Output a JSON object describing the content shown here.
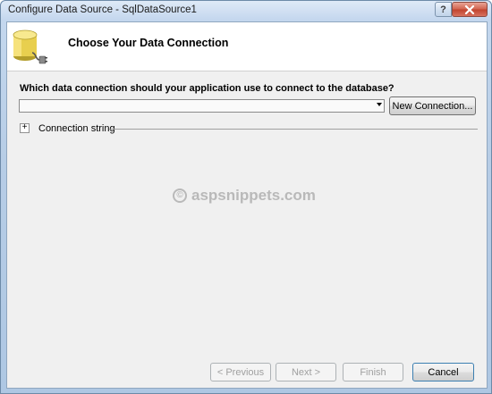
{
  "window": {
    "title": "Configure Data Source - SqlDataSource1",
    "help_label": "?",
    "close_label": "✕"
  },
  "header": {
    "icon": "database-icon",
    "title": "Choose Your Data Connection"
  },
  "connection": {
    "question": "Which data connection should your application use to connect to the database?",
    "selected_value": "",
    "new_connection_label": "New Connection...",
    "expander_label": "+",
    "connection_string_label": "Connection string"
  },
  "watermark": {
    "symbol": "©",
    "text": "aspsnippets.com"
  },
  "footer": {
    "previous_label": "< Previous",
    "next_label": "Next >",
    "finish_label": "Finish",
    "cancel_label": "Cancel"
  },
  "colors": {
    "close_button": "#c7432f",
    "primary_border": "#3c7fb1",
    "watermark": "#b9b9b9"
  }
}
